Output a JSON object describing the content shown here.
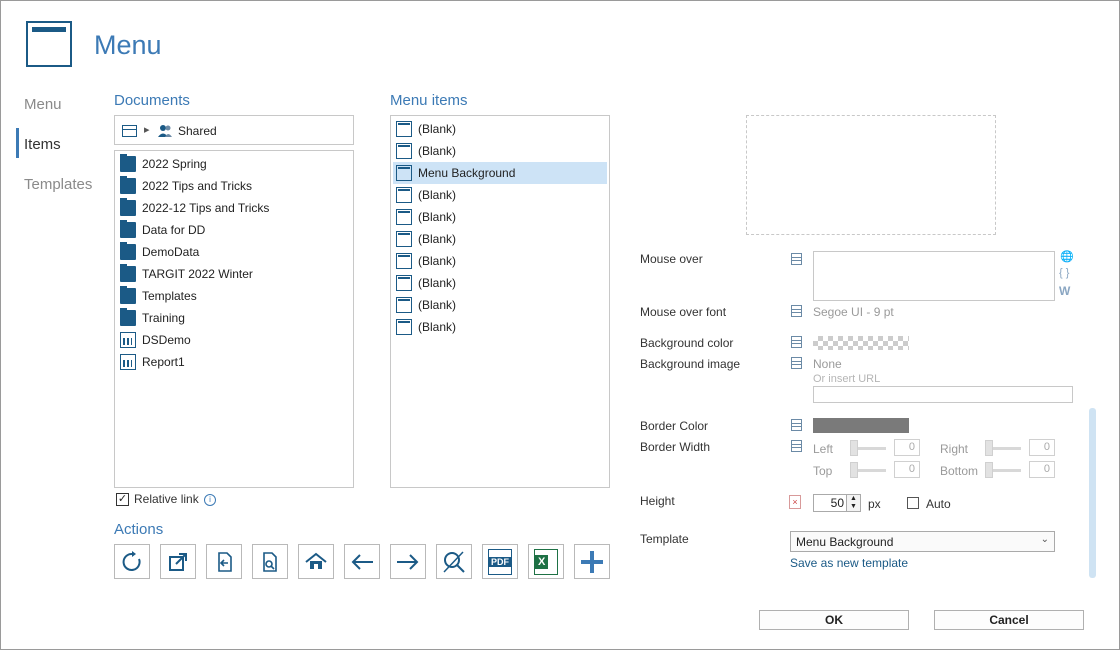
{
  "header": {
    "title": "Menu"
  },
  "nav": {
    "items": [
      {
        "label": "Menu"
      },
      {
        "label": "Items"
      },
      {
        "label": "Templates"
      }
    ],
    "active": "Items"
  },
  "documents": {
    "heading": "Documents",
    "breadcrumb": "Shared",
    "items": [
      {
        "label": "2022 Spring",
        "icon": "folder-icon"
      },
      {
        "label": "2022 Tips and Tricks",
        "icon": "folder-icon"
      },
      {
        "label": "2022-12 Tips and Tricks",
        "icon": "folder-icon"
      },
      {
        "label": "Data for DD",
        "icon": "folder-icon"
      },
      {
        "label": "DemoData",
        "icon": "folder-icon"
      },
      {
        "label": "TARGIT 2022 Winter",
        "icon": "folder-icon"
      },
      {
        "label": "Templates",
        "icon": "folder-icon"
      },
      {
        "label": "Training",
        "icon": "folder-icon"
      },
      {
        "label": "DSDemo",
        "icon": "report-icon"
      },
      {
        "label": "Report1",
        "icon": "report-icon"
      }
    ],
    "relative_link_label": "Relative link",
    "relative_link_checked": true
  },
  "menu_items": {
    "heading": "Menu items",
    "items": [
      {
        "label": "(Blank)"
      },
      {
        "label": "(Blank)"
      },
      {
        "label": "Menu Background",
        "selected": true
      },
      {
        "label": "(Blank)"
      },
      {
        "label": "(Blank)"
      },
      {
        "label": "(Blank)"
      },
      {
        "label": "(Blank)"
      },
      {
        "label": "(Blank)"
      },
      {
        "label": "(Blank)"
      },
      {
        "label": "(Blank)"
      }
    ]
  },
  "actions": {
    "heading": "Actions",
    "buttons": [
      "refresh-icon",
      "open-external-icon",
      "import-icon",
      "find-document-icon",
      "home-icon",
      "back-arrow-icon",
      "forward-arrow-icon",
      "no-search-icon",
      "pdf-icon",
      "excel-icon",
      "add-icon"
    ],
    "pdf_text": "PDF",
    "excel_text": "X"
  },
  "props": {
    "mouse_over_label": "Mouse over",
    "mouse_over_value": "",
    "mouse_over_font_label": "Mouse over font",
    "mouse_over_font_value": "Segoe UI - 9 pt",
    "bg_color_label": "Background color",
    "bg_image_label": "Background image",
    "bg_image_value": "None",
    "bg_image_url_placeholder": "Or insert URL",
    "border_color_label": "Border Color",
    "border_color_value": "#7a7a7a",
    "border_width_label": "Border Width",
    "left_label": "Left",
    "left_value": "0",
    "right_label": "Right",
    "right_value": "0",
    "top_label": "Top",
    "top_value": "0",
    "bottom_label": "Bottom",
    "bottom_value": "0",
    "height_label": "Height",
    "height_value": "50",
    "height_unit": "px",
    "auto_label": "Auto",
    "auto_checked": false,
    "template_label": "Template",
    "template_value": "Menu Background",
    "save_template_label": "Save as new template",
    "side_icons": {
      "globe": "🌐",
      "braces": "{ }",
      "word": "W"
    }
  },
  "footer": {
    "ok_label": "OK",
    "cancel_label": "Cancel"
  },
  "colors": {
    "accent": "#3c7ab5",
    "icon": "#1b5a86",
    "selection": "#cde3f6"
  }
}
